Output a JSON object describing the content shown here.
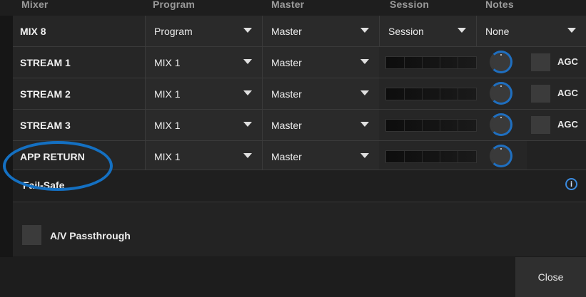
{
  "header": {
    "col_labels": [
      "Mixer",
      "Program",
      "Master",
      "Session",
      "Notes"
    ]
  },
  "rows": [
    {
      "name": "MIX 8",
      "source": "Program",
      "bus": "Master",
      "mode": "Session",
      "extra": "None"
    },
    {
      "name": "STREAM 1",
      "source": "MIX 1",
      "bus": "Master",
      "agc": "AGC"
    },
    {
      "name": "STREAM 2",
      "source": "MIX 1",
      "bus": "Master",
      "agc": "AGC"
    },
    {
      "name": "STREAM 3",
      "source": "MIX 1",
      "bus": "Master",
      "agc": "AGC"
    },
    {
      "name": "APP RETURN",
      "source": "MIX 1",
      "bus": "Master"
    }
  ],
  "failsafe": {
    "label": "Fail-Safe",
    "info_icon": "info-icon",
    "info_glyph": "i"
  },
  "passthrough": {
    "label": "A/V Passthrough"
  },
  "footer": {
    "close_label": "Close"
  },
  "colors": {
    "accent": "#1470c2",
    "knob_ring": "#1f6fc0",
    "background": "#1b1b1b"
  }
}
